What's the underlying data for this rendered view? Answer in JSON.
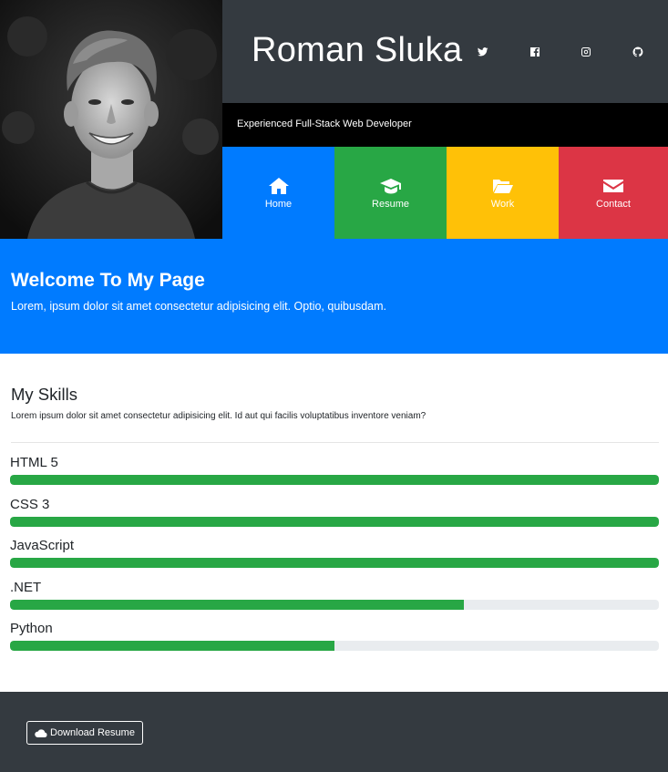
{
  "header": {
    "name": "Roman Sluka",
    "tagline": "Experienced Full-Stack Web Developer",
    "social": [
      {
        "icon": "twitter-icon"
      },
      {
        "icon": "facebook-icon"
      },
      {
        "icon": "instagram-icon"
      },
      {
        "icon": "github-icon"
      }
    ]
  },
  "nav": [
    {
      "label": "Home",
      "icon": "home-icon",
      "color": "#007bff"
    },
    {
      "label": "Resume",
      "icon": "graduation-cap-icon",
      "color": "#28a745"
    },
    {
      "label": "Work",
      "icon": "folder-open-icon",
      "color": "#ffc107"
    },
    {
      "label": "Contact",
      "icon": "envelope-icon",
      "color": "#dc3545"
    }
  ],
  "welcome": {
    "title": "Welcome To My Page",
    "text": "Lorem, ipsum dolor sit amet consectetur adipisicing elit. Optio, quibusdam."
  },
  "skills": {
    "title": "My Skills",
    "intro": "Lorem ipsum dolor sit amet consectetur adipisicing elit. Id aut qui facilis voluptatibus inventore veniam?",
    "items": [
      {
        "name": "HTML 5",
        "percent": 100
      },
      {
        "name": "CSS 3",
        "percent": 100
      },
      {
        "name": "JavaScript",
        "percent": 100
      },
      {
        "name": ".NET",
        "percent": 70
      },
      {
        "name": "Python",
        "percent": 50
      }
    ]
  },
  "footer": {
    "download_label": "Download Resume",
    "download_icon": "cloud-icon"
  },
  "colors": {
    "primary": "#007bff",
    "success": "#28a745",
    "warning": "#ffc107",
    "danger": "#dc3545",
    "dark": "#343a40"
  }
}
